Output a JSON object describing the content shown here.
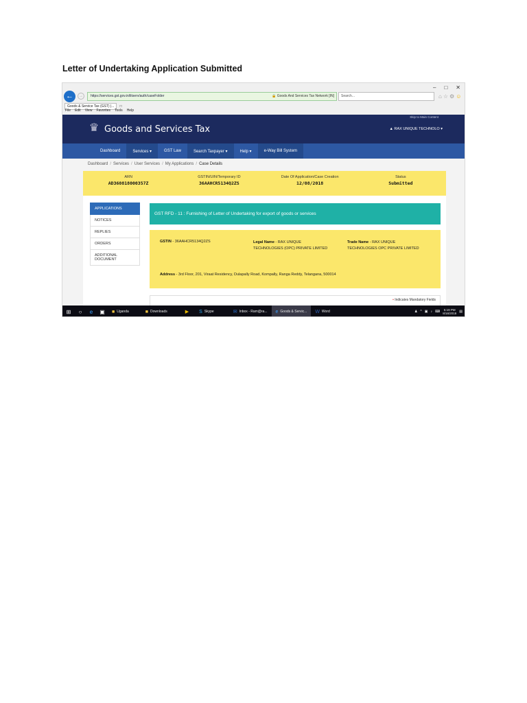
{
  "doc_title": "Letter of Undertaking Application Submitted",
  "browser": {
    "window_controls": [
      "–",
      "□",
      "✕"
    ],
    "url": "https://services.gst.gov.in/litserv/auth/caseFolder",
    "site_label": "Goods And Services Tax Network [IN]",
    "search_placeholder": "Search...",
    "tab_title": "Goods & Service Tax (GST) |...",
    "menu": [
      "File",
      "Edit",
      "View",
      "Favorites",
      "Tools",
      "Help"
    ]
  },
  "header": {
    "title": "Goods and Services Tax",
    "user": "RAX UNIQUE TECHNOLO",
    "small_link": "Skip to Main Content"
  },
  "nav": {
    "items": [
      "Dashboard",
      "Services ▾",
      "GST Law",
      "Search Taxpayer ▾",
      "Help ▾",
      "e-Way Bill System"
    ]
  },
  "breadcrumb": [
    "Dashboard",
    "Services",
    "User Services",
    "My Applications",
    "Case Details"
  ],
  "info": [
    {
      "label": "ARN",
      "value": "AD360818000357Z"
    },
    {
      "label": "GSTIN/UIN/Temporary ID",
      "value": "36AAHCR5134Q2ZS"
    },
    {
      "label": "Date Of Application/Case Creation",
      "value": "12/08/2018"
    },
    {
      "label": "Status",
      "value": "Submitted"
    }
  ],
  "side_menu": [
    "APPLICATIONS",
    "NOTICES",
    "REPLIES",
    "ORDERS",
    "ADDITIONAL DOCUMENT"
  ],
  "form": {
    "heading": "GST RFD - 11 : Furnishing of Letter of Undertaking for export of goods or services",
    "gstin_label": "GSTIN",
    "gstin_value": "36AAHCR5134Q2ZS",
    "legal_label": "Legal Name",
    "legal_value": "RAX UNIQUE TECHNOLOGIES (OPC) PRIVATE LIMITED",
    "trade_label": "Trade Name",
    "trade_value": "RAX UNIQUE TECHNOLOGIES OPC PRIVATE LIMITED",
    "address_label": "Address",
    "address_value": "3rd Floor, 201, Viraat Residency, Dulapally Road, Kompally, Ranga Reddy, Telangana, 500014",
    "mandatory_note": "Indicates Mandatory Fields"
  },
  "taskbar": {
    "apps": [
      "Uganda",
      "Downloads",
      "",
      "Skype",
      "Inbox - Ram@ra...",
      "Goods & Servic...",
      "Word"
    ],
    "time": "5:19 PM",
    "date": "8/16/2018"
  }
}
